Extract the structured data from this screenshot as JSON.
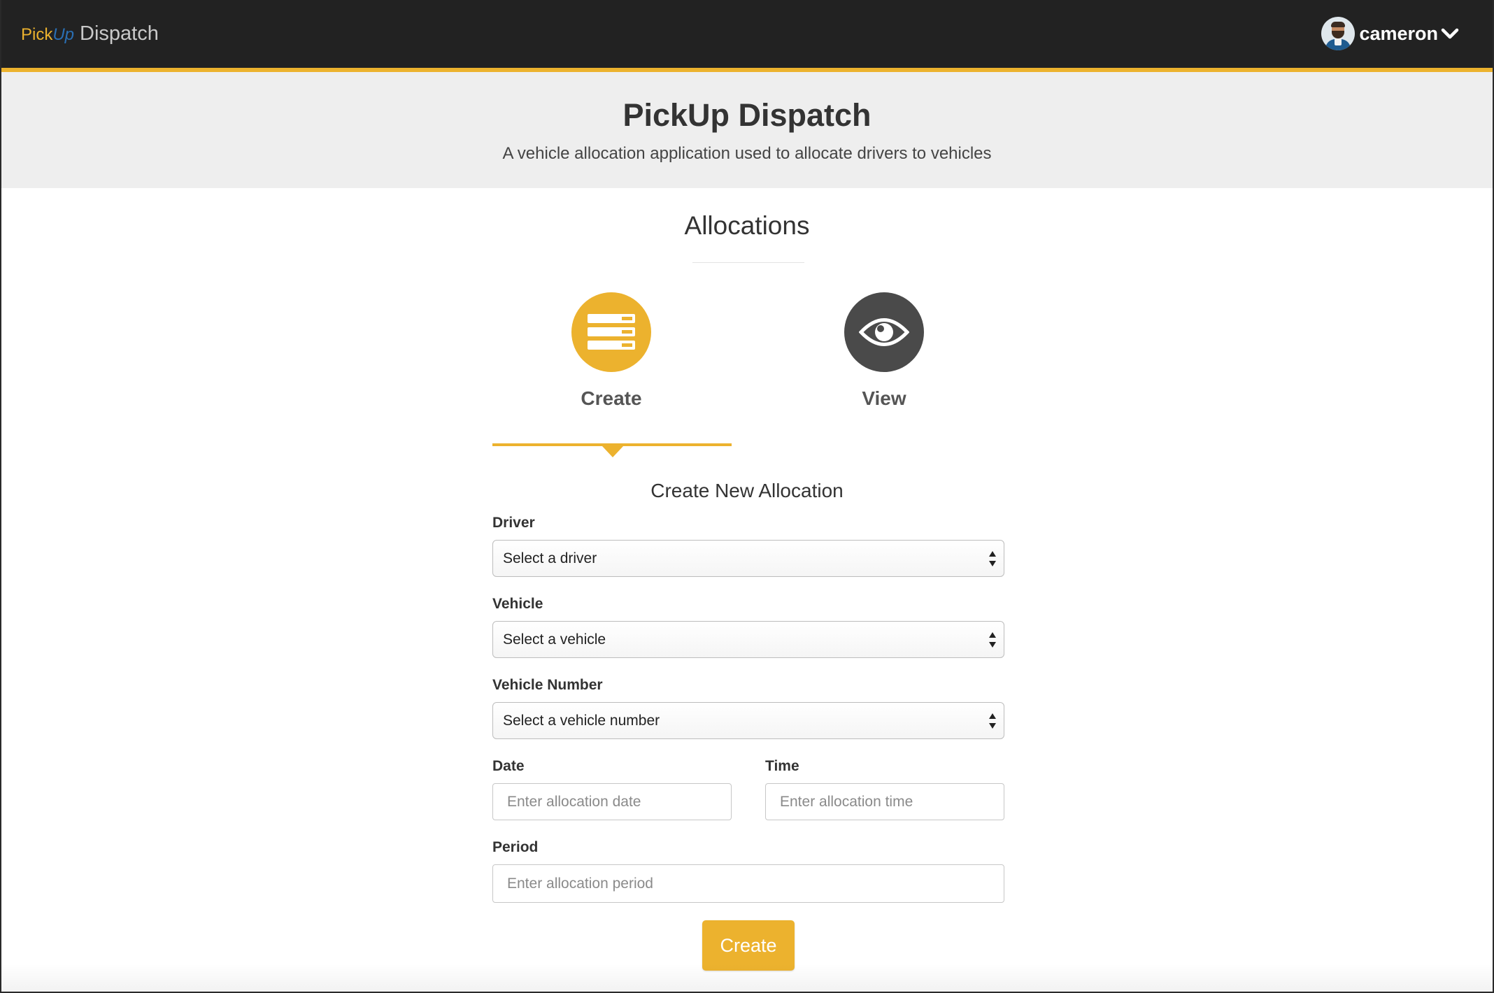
{
  "navbar": {
    "brand_pick": "Pick",
    "brand_up": "Up",
    "brand_dispatch": "Dispatch",
    "username": "cameron"
  },
  "jumbotron": {
    "title": "PickUp Dispatch",
    "subtitle": "A vehicle allocation application used to allocate drivers to vehicles"
  },
  "section": {
    "title": "Allocations"
  },
  "tabs": [
    {
      "label": "Create",
      "icon": "list-icon",
      "active": true
    },
    {
      "label": "View",
      "icon": "eye-icon",
      "active": false
    }
  ],
  "form": {
    "title": "Create New Allocation",
    "driver": {
      "label": "Driver",
      "selected": "Select a driver"
    },
    "vehicle": {
      "label": "Vehicle",
      "selected": "Select a vehicle"
    },
    "vehicle_number": {
      "label": "Vehicle Number",
      "selected": "Select a vehicle number"
    },
    "date": {
      "label": "Date",
      "placeholder": "Enter allocation date"
    },
    "time": {
      "label": "Time",
      "placeholder": "Enter allocation time"
    },
    "period": {
      "label": "Period",
      "placeholder": "Enter allocation period"
    },
    "submit_label": "Create"
  },
  "colors": {
    "accent": "#ecb22e",
    "navbar": "#222222",
    "brand_up": "#2a6fb4",
    "view_circle": "#4a4a4a",
    "jumbotron": "#eeeeee"
  }
}
